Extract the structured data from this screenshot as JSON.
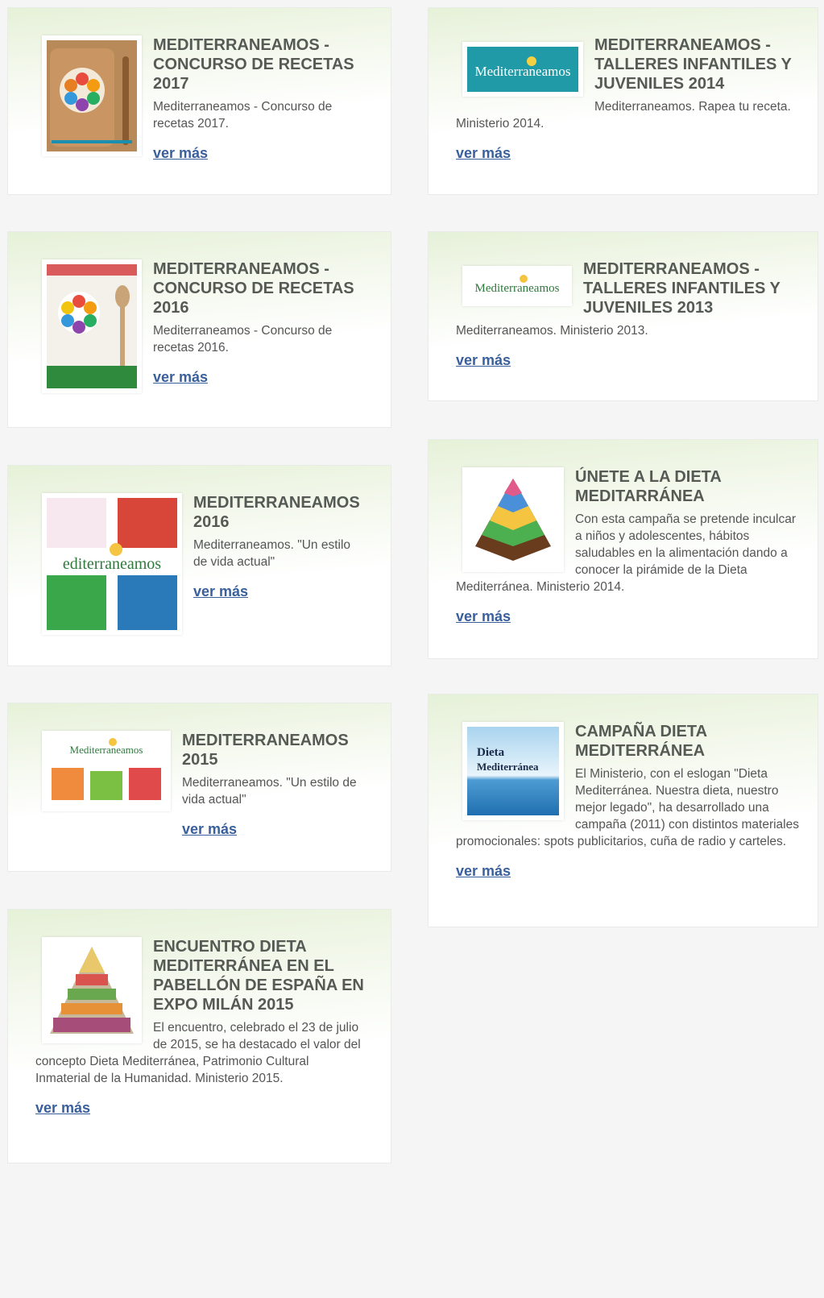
{
  "cards": [
    {
      "title": "MEDITERRANEAMOS - CONCURSO DE RECETAS 2017",
      "desc": "Mediterraneamos - Concurso de recetas 2017.",
      "link": "ver más"
    },
    {
      "title": "MEDITERRANEAMOS - TALLERES INFANTILES Y JUVENILES 2014",
      "desc": "Mediterraneamos. Rapea tu receta. Ministerio 2014.",
      "link": "ver más"
    },
    {
      "title": "MEDITERRANEAMOS - CONCURSO DE RECETAS 2016",
      "desc": "Mediterraneamos - Concurso de recetas 2016.",
      "link": "ver más"
    },
    {
      "title": "MEDITERRANEAMOS - TALLERES INFANTILES Y JUVENILES 2013",
      "desc": "Mediterraneamos. Ministerio 2013.",
      "link": "ver más"
    },
    {
      "title": "MEDITERRANEAMOS 2016",
      "desc": "Mediterraneamos. \"Un estilo de vida actual\"",
      "link": "ver más"
    },
    {
      "title": "ÚNETE A LA DIETA MEDITARRÁNEA",
      "desc": "Con esta campaña se pretende inculcar a niños y adolescentes, hábitos saludables en la alimentación dando a conocer la pirámide de la Dieta Mediterránea. Ministerio 2014.",
      "link": "ver más"
    },
    {
      "title": "MEDITERRANEAMOS 2015",
      "desc": "Mediterraneamos. \"Un estilo de vida actual\"",
      "link": "ver más"
    },
    {
      "title": "CAMPAÑA DIETA MEDITERRÁNEA",
      "desc": "El Ministerio, con el eslogan \"Dieta Mediterránea. Nuestra dieta, nuestro mejor legado\", ha desarrollado una campaña (2011) con distintos materiales promocionales: spots publicitarios, cuña de radio y carteles.",
      "link": "ver más"
    },
    {
      "title": "ENCUENTRO DIETA MEDITERRÁNEA EN EL PABELLÓN DE ESPAÑA EN EXPO MILÁN 2015",
      "desc": "El encuentro, celebrado el 23 de julio de 2015, se ha destacado el valor del concepto Dieta Mediterránea, Patrimonio Cultural Inmaterial de la Humanidad. Ministerio 2015.",
      "link": "ver más"
    }
  ],
  "thumbs": {
    "logo_word": "Mediterraneamos",
    "logo_word_alt": "editerraneamos",
    "dieta_line1": "Dieta",
    "dieta_line2": "Mediterránea"
  }
}
